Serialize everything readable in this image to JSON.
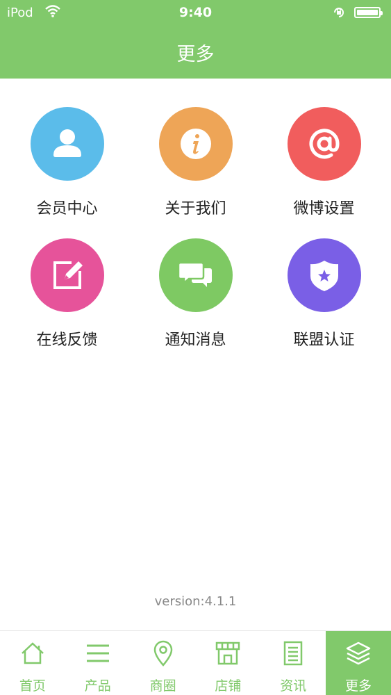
{
  "status_bar": {
    "carrier": "iPod",
    "time": "9:40"
  },
  "header": {
    "title": "更多"
  },
  "menu": [
    {
      "label": "会员中心",
      "icon": "user-icon",
      "color": "#5bbcea"
    },
    {
      "label": "关于我们",
      "icon": "info-icon",
      "color": "#eea557"
    },
    {
      "label": "微博设置",
      "icon": "at-icon",
      "color": "#f15d5d"
    },
    {
      "label": "在线反馈",
      "icon": "edit-icon",
      "color": "#e6539a"
    },
    {
      "label": "通知消息",
      "icon": "chat-icon",
      "color": "#7ec963"
    },
    {
      "label": "联盟认证",
      "icon": "shield-star-icon",
      "color": "#7a5fe6"
    }
  ],
  "version": "version:4.1.1",
  "tabbar": {
    "tabs": [
      {
        "label": "首页",
        "icon": "home-icon"
      },
      {
        "label": "产品",
        "icon": "list-icon"
      },
      {
        "label": "商圈",
        "icon": "location-icon"
      },
      {
        "label": "店铺",
        "icon": "store-icon"
      },
      {
        "label": "资讯",
        "icon": "document-icon"
      },
      {
        "label": "更多",
        "icon": "layers-icon",
        "active": true
      }
    ]
  }
}
